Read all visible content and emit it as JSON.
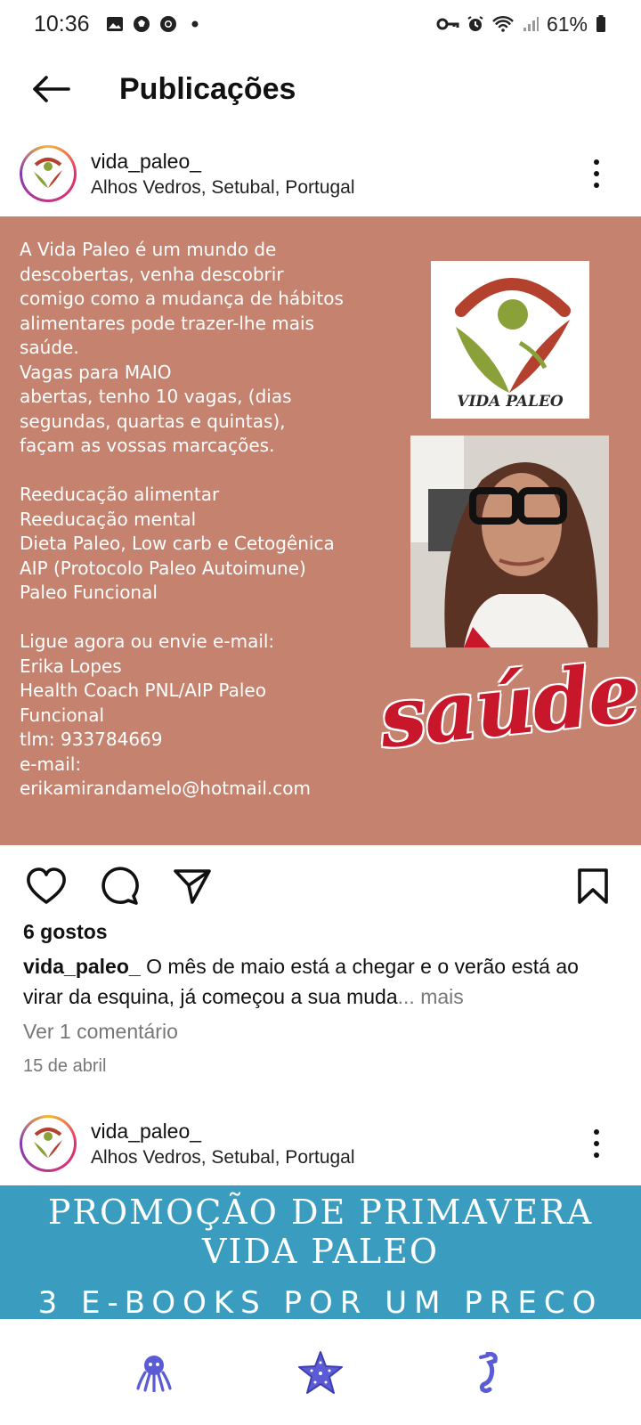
{
  "status_bar": {
    "time": "10:36",
    "battery": "61%",
    "icons": [
      "gallery-icon",
      "soccer-icon",
      "chrome-icon",
      "dot-icon",
      "key-icon",
      "alarm-icon",
      "wifi-icon",
      "signal-icon",
      "battery-icon"
    ]
  },
  "header": {
    "title": "Publicações"
  },
  "post1": {
    "username": "vida_paleo_",
    "location": "Alhos Vedros, Setubal, Portugal",
    "image": {
      "text": "A Vida Paleo é um mundo de\ndescobertas, venha descobrir\ncomigo como a mudança de hábitos\nalimentares pode trazer-lhe mais\nsaúde.\nVagas para MAIO\nabertas, tenho 10 vagas, (dias\nsegundas, quartas e quintas),\nfaçam as vossas marcações.\n\nReeducação alimentar\nReeducação mental\nDieta Paleo, Low carb e Cetogênica\nAIP (Protocolo Paleo Autoimune)\nPaleo Funcional\n\nLigue agora ou envie e-mail:\nErika Lopes\nHealth Coach PNL/AIP Paleo\nFuncional\ntlm: 933784669\ne-mail:\nerikamirandamelo@hotmail.com",
      "logo_text": "VIDA PALEO",
      "script_word": "saúde"
    },
    "likes": "6 gostos",
    "caption_user": "vida_paleo_",
    "caption_text": " O mês de maio está a chegar e o verão está ao virar da esquina, já começou a sua muda",
    "caption_more": "... mais",
    "view_comments": "Ver 1 comentário",
    "date": "15 de abril"
  },
  "post2": {
    "username": "vida_paleo_",
    "location": "Alhos Vedros, Setubal, Portugal",
    "banner_line1": "PROMOÇÃO DE PRIMAVERA",
    "banner_line2": "VIDA PALEO",
    "banner_line3": "3 E-BOOKS POR UM PRECO"
  },
  "colors": {
    "post_bg": "#c5836f",
    "banner_bg": "#3a9dc0",
    "nav_icon": "#5b5bd6",
    "saude_red": "#c8162a"
  },
  "bottom_nav": {
    "icons": [
      "octopus-icon",
      "starfish-icon",
      "seahorse-icon"
    ]
  }
}
